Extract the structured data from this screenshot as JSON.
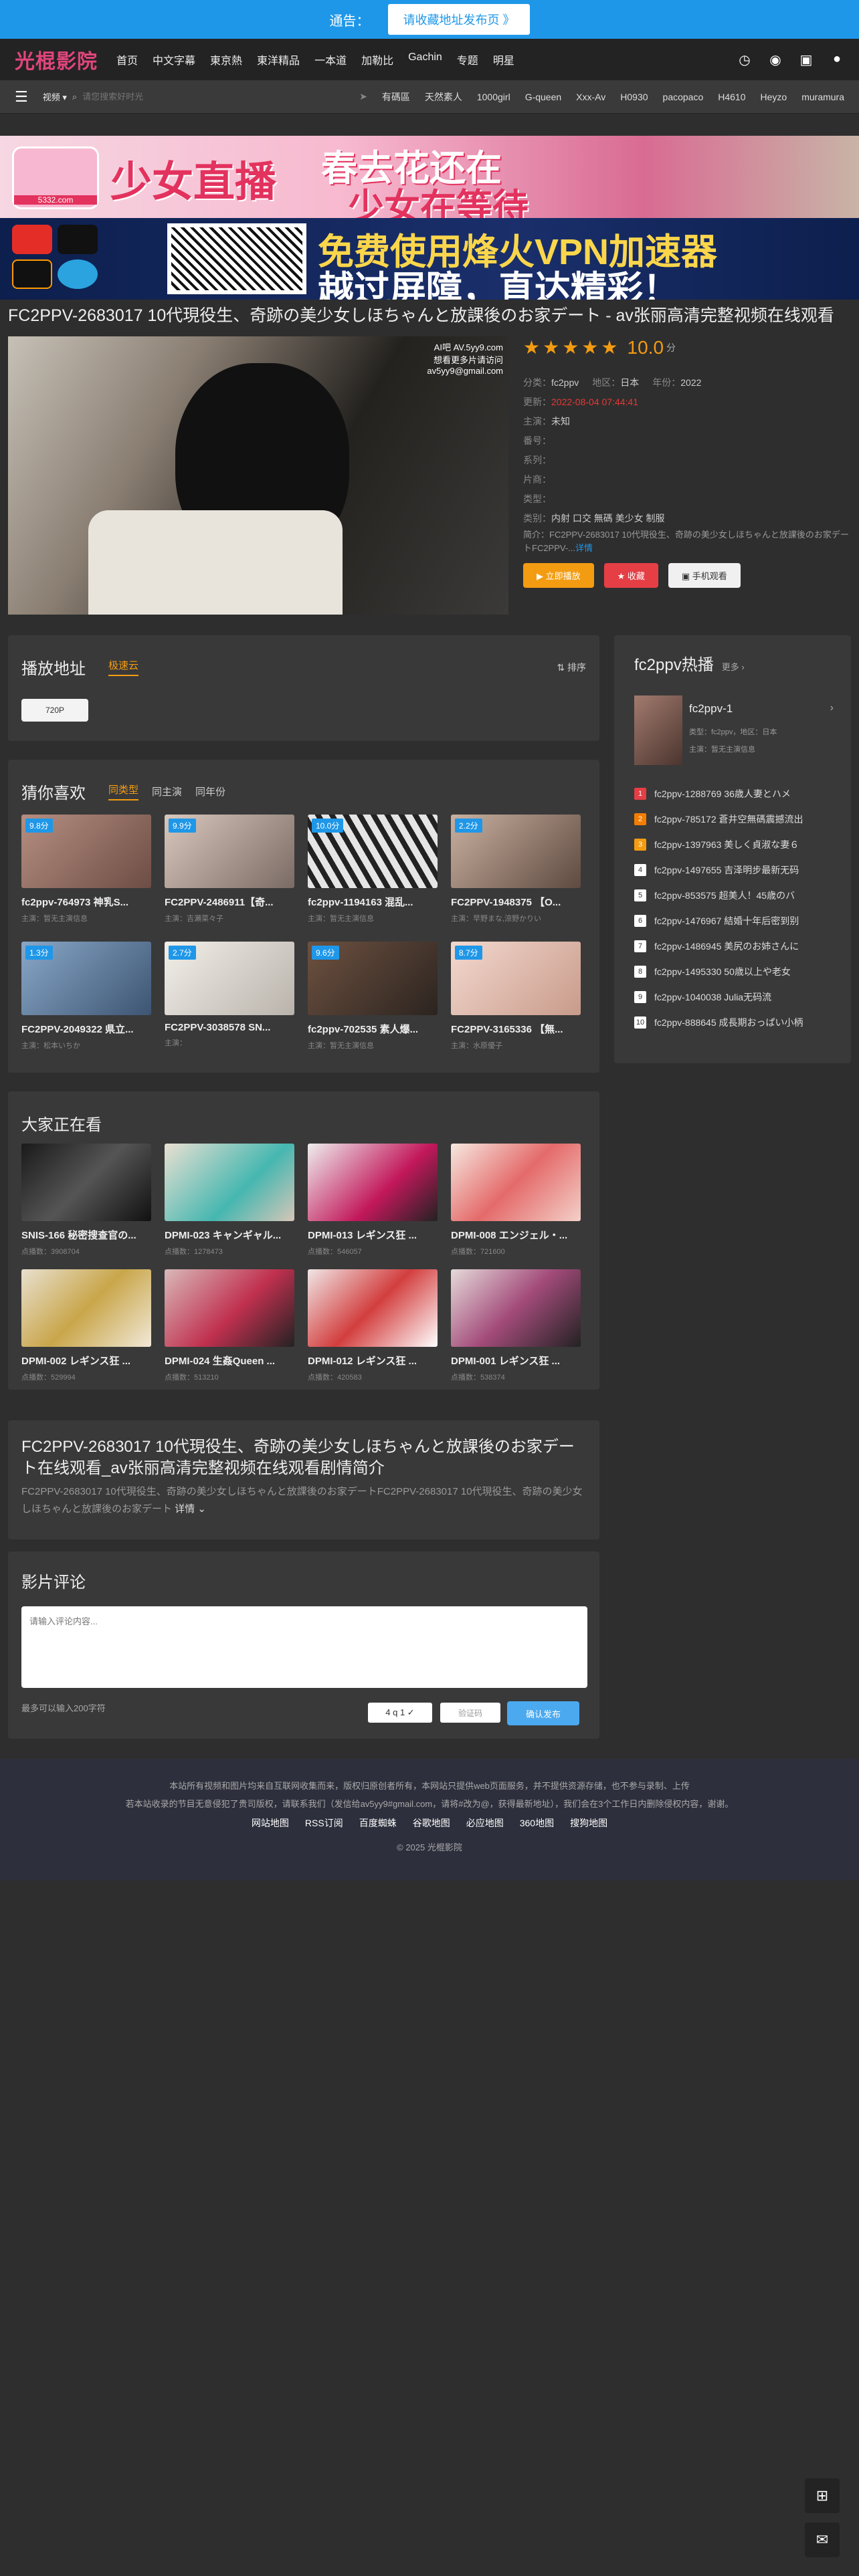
{
  "notice": {
    "label": "通告：",
    "button": "请收藏地址发布页 》"
  },
  "header": {
    "logo": "光棍影院",
    "menu": [
      "首页",
      "中文字幕",
      "東京熱",
      "東洋精品",
      "一本道",
      "加勒比",
      "Gachin",
      "专题",
      "明星"
    ]
  },
  "subnav": {
    "search_select": "视频 ▾",
    "search_placeholder": "请您搜索好时光",
    "hot": [
      "有碼區",
      "天然素人",
      "1000girl",
      "G-queen",
      "Xxx-Av",
      "H0930",
      "pacopaco",
      "H4610",
      "Heyzo",
      "muramura"
    ]
  },
  "ads": {
    "ad1_text1": "少女直播",
    "ad1_site": "5332.com",
    "ad1_text2": "春去花还在",
    "ad1_text3": "少女在等待",
    "ad2_text1": "免费使用烽火VPN加速器",
    "ad2_text2": "越过屏障，直达精彩！"
  },
  "video": {
    "title": "FC2PPV-2683017 10代現役生、奇跡の美少女しほちゃんと放課後のお家デート - av张丽高清完整视频在线观看",
    "watermark": "AI吧 AV.5yy9.com",
    "watermark2": "想看更多片请访问",
    "watermark3": "av5yy9@gmail.com",
    "score": "10.0",
    "score_unit": "分",
    "category_label": "分类：",
    "category": "fc2ppv",
    "region_label": "地区：",
    "region": "日本",
    "year_label": "年份：",
    "year": "2022",
    "update_label": "更新：",
    "update": "2022-08-04 07:44:41",
    "actor_label": "主演：",
    "actor": "未知",
    "fanhao_label": "番号：",
    "series_label": "系列：",
    "maker_label": "片商：",
    "type_label": "类型：",
    "genre_label": "类别：",
    "genre": "内射 口交 無碼 美少女 制服",
    "intro_label": "简介：",
    "intro": "FC2PPV-2683017 10代現役生、奇跡の美少女しほちゃんと放課後のお家デートFC2PPV-...",
    "intro_more": "详情",
    "btn_play": "▶ 立即播放",
    "btn_fav": "★ 收藏",
    "btn_mobile": "▣ 手机观看"
  },
  "play": {
    "title": "播放地址",
    "tab": "极速云",
    "sort": "⇅ 排序",
    "ep": "720P"
  },
  "guess": {
    "title": "猜你喜欢",
    "tabs": [
      "同类型",
      "同主演",
      "同年份"
    ],
    "items": [
      {
        "badge": "9.8分",
        "title": "fc2ppv-764973 神乳S...",
        "sub": "主演：暂无主演信息"
      },
      {
        "badge": "9.9分",
        "title": "FC2PPV-2486911【奇...",
        "sub": "主演：吉瀬菜々子"
      },
      {
        "badge": "10.0分",
        "title": "fc2ppv-1194163 混乱...",
        "sub": "主演：暂无主演信息"
      },
      {
        "badge": "2.2分",
        "title": "FC2PPV-1948375 【O...",
        "sub": "主演：早野まな,涼野かりい"
      },
      {
        "badge": "1.3分",
        "title": "FC2PPV-2049322 県立...",
        "sub": "主演：松本いちか"
      },
      {
        "badge": "2.7分",
        "title": "FC2PPV-3038578 SN...",
        "sub": "主演："
      },
      {
        "badge": "9.6分",
        "title": "fc2ppv-702535 素人爆...",
        "sub": "主演：暂无主演信息"
      },
      {
        "badge": "8.7分",
        "title": "FC2PPV-3165336 【無...",
        "sub": "主演：水原優子"
      }
    ]
  },
  "watching": {
    "title": "大家正在看",
    "items": [
      {
        "title": "SNIS-166 秘密搜查官の...",
        "views": "点播数：3908704"
      },
      {
        "title": "DPMI-023 キャンギャル...",
        "views": "点播数：1278473"
      },
      {
        "title": "DPMI-013 レギンス狂 ...",
        "views": "点播数：546057"
      },
      {
        "title": "DPMI-008 エンジェル・...",
        "views": "点播数：721600"
      },
      {
        "title": "DPMI-002 レギンス狂 ...",
        "views": "点播数：529994"
      },
      {
        "title": "DPMI-024 生姦Queen ...",
        "views": "点播数：513210"
      },
      {
        "title": "DPMI-012 レギンス狂 ...",
        "views": "点播数：420583"
      },
      {
        "title": "DPMI-001 レギンス狂 ...",
        "views": "点播数：538374"
      }
    ]
  },
  "summary": {
    "title": "FC2PPV-2683017 10代現役生、奇跡の美少女しほちゃんと放課後のお家デート在线观看_av张丽高清完整视频在线观看剧情简介",
    "text": "FC2PPV-2683017 10代現役生、奇跡の美少女しほちゃんと放課後のお家デートFC2PPV-2683017 10代現役生、奇跡の美少女しほちゃんと放課後のお家デート",
    "more": "详情 ⌄"
  },
  "comments": {
    "title": "影片评论",
    "placeholder": "请输入评论内容...",
    "limit": "最多可以输入200字符",
    "captcha": "4 q 1 ✓",
    "captcha_ph": "验证码",
    "submit": "确认发布"
  },
  "hotlist": {
    "title": "fc2ppv热播",
    "more": "更多 ›",
    "top": {
      "title": "fc2ppv-1",
      "sub1": "类型：fc2ppv，地区：日本",
      "sub2": "主演：暂无主演信息"
    },
    "items": [
      "fc2ppv-1288769 36歳人妻とハメ",
      "fc2ppv-785172 蒼井空無碼震撼流出",
      "fc2ppv-1397963 美しく貞淑な妻６",
      "fc2ppv-1497655 吉泽明步最新无码",
      "fc2ppv-853575 超美人！45歳のバ",
      "fc2ppv-1476967 結婚十年后密到别",
      "fc2ppv-1486945 美尻のお姉さんに",
      "fc2ppv-1495330 50歳以上や老女",
      "fc2ppv-1040038 Julia无码流",
      "fc2ppv-888645 成長期おっぱい小柄"
    ]
  },
  "footer": {
    "line1": "本站所有视频和图片均来自互联网收集而来，版权归原创者所有，本网站只提供web页面服务，并不提供资源存储，也不参与录制、上传",
    "line2": "若本站收录的节目无意侵犯了贵司版权，请联系我们（发信给av5yy9#gmail.com，请将#改为@，获得最新地址），我们会在3个工作日内删除侵权内容，谢谢。",
    "links": [
      "网站地图",
      "RSS订阅",
      "百度蜘蛛",
      "谷歌地图",
      "必应地图",
      "360地图",
      "搜狗地图"
    ],
    "copy": "© 2025 光棍影院"
  }
}
